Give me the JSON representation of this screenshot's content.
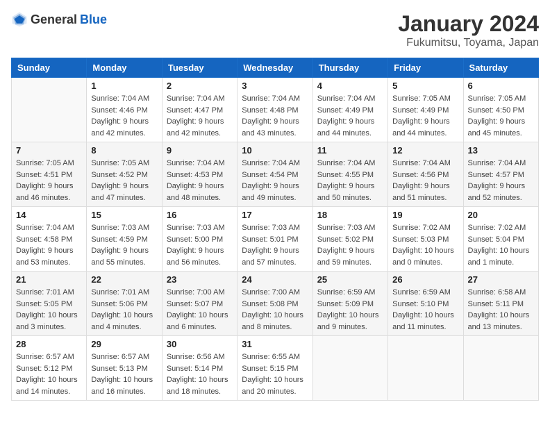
{
  "header": {
    "logo_general": "General",
    "logo_blue": "Blue",
    "month": "January 2024",
    "location": "Fukumitsu, Toyama, Japan"
  },
  "weekdays": [
    "Sunday",
    "Monday",
    "Tuesday",
    "Wednesday",
    "Thursday",
    "Friday",
    "Saturday"
  ],
  "weeks": [
    [
      {
        "day": "",
        "info": ""
      },
      {
        "day": "1",
        "info": "Sunrise: 7:04 AM\nSunset: 4:46 PM\nDaylight: 9 hours\nand 42 minutes."
      },
      {
        "day": "2",
        "info": "Sunrise: 7:04 AM\nSunset: 4:47 PM\nDaylight: 9 hours\nand 42 minutes."
      },
      {
        "day": "3",
        "info": "Sunrise: 7:04 AM\nSunset: 4:48 PM\nDaylight: 9 hours\nand 43 minutes."
      },
      {
        "day": "4",
        "info": "Sunrise: 7:04 AM\nSunset: 4:49 PM\nDaylight: 9 hours\nand 44 minutes."
      },
      {
        "day": "5",
        "info": "Sunrise: 7:05 AM\nSunset: 4:49 PM\nDaylight: 9 hours\nand 44 minutes."
      },
      {
        "day": "6",
        "info": "Sunrise: 7:05 AM\nSunset: 4:50 PM\nDaylight: 9 hours\nand 45 minutes."
      }
    ],
    [
      {
        "day": "7",
        "info": "Sunrise: 7:05 AM\nSunset: 4:51 PM\nDaylight: 9 hours\nand 46 minutes."
      },
      {
        "day": "8",
        "info": "Sunrise: 7:05 AM\nSunset: 4:52 PM\nDaylight: 9 hours\nand 47 minutes."
      },
      {
        "day": "9",
        "info": "Sunrise: 7:04 AM\nSunset: 4:53 PM\nDaylight: 9 hours\nand 48 minutes."
      },
      {
        "day": "10",
        "info": "Sunrise: 7:04 AM\nSunset: 4:54 PM\nDaylight: 9 hours\nand 49 minutes."
      },
      {
        "day": "11",
        "info": "Sunrise: 7:04 AM\nSunset: 4:55 PM\nDaylight: 9 hours\nand 50 minutes."
      },
      {
        "day": "12",
        "info": "Sunrise: 7:04 AM\nSunset: 4:56 PM\nDaylight: 9 hours\nand 51 minutes."
      },
      {
        "day": "13",
        "info": "Sunrise: 7:04 AM\nSunset: 4:57 PM\nDaylight: 9 hours\nand 52 minutes."
      }
    ],
    [
      {
        "day": "14",
        "info": "Sunrise: 7:04 AM\nSunset: 4:58 PM\nDaylight: 9 hours\nand 53 minutes."
      },
      {
        "day": "15",
        "info": "Sunrise: 7:03 AM\nSunset: 4:59 PM\nDaylight: 9 hours\nand 55 minutes."
      },
      {
        "day": "16",
        "info": "Sunrise: 7:03 AM\nSunset: 5:00 PM\nDaylight: 9 hours\nand 56 minutes."
      },
      {
        "day": "17",
        "info": "Sunrise: 7:03 AM\nSunset: 5:01 PM\nDaylight: 9 hours\nand 57 minutes."
      },
      {
        "day": "18",
        "info": "Sunrise: 7:03 AM\nSunset: 5:02 PM\nDaylight: 9 hours\nand 59 minutes."
      },
      {
        "day": "19",
        "info": "Sunrise: 7:02 AM\nSunset: 5:03 PM\nDaylight: 10 hours\nand 0 minutes."
      },
      {
        "day": "20",
        "info": "Sunrise: 7:02 AM\nSunset: 5:04 PM\nDaylight: 10 hours\nand 1 minute."
      }
    ],
    [
      {
        "day": "21",
        "info": "Sunrise: 7:01 AM\nSunset: 5:05 PM\nDaylight: 10 hours\nand 3 minutes."
      },
      {
        "day": "22",
        "info": "Sunrise: 7:01 AM\nSunset: 5:06 PM\nDaylight: 10 hours\nand 4 minutes."
      },
      {
        "day": "23",
        "info": "Sunrise: 7:00 AM\nSunset: 5:07 PM\nDaylight: 10 hours\nand 6 minutes."
      },
      {
        "day": "24",
        "info": "Sunrise: 7:00 AM\nSunset: 5:08 PM\nDaylight: 10 hours\nand 8 minutes."
      },
      {
        "day": "25",
        "info": "Sunrise: 6:59 AM\nSunset: 5:09 PM\nDaylight: 10 hours\nand 9 minutes."
      },
      {
        "day": "26",
        "info": "Sunrise: 6:59 AM\nSunset: 5:10 PM\nDaylight: 10 hours\nand 11 minutes."
      },
      {
        "day": "27",
        "info": "Sunrise: 6:58 AM\nSunset: 5:11 PM\nDaylight: 10 hours\nand 13 minutes."
      }
    ],
    [
      {
        "day": "28",
        "info": "Sunrise: 6:57 AM\nSunset: 5:12 PM\nDaylight: 10 hours\nand 14 minutes."
      },
      {
        "day": "29",
        "info": "Sunrise: 6:57 AM\nSunset: 5:13 PM\nDaylight: 10 hours\nand 16 minutes."
      },
      {
        "day": "30",
        "info": "Sunrise: 6:56 AM\nSunset: 5:14 PM\nDaylight: 10 hours\nand 18 minutes."
      },
      {
        "day": "31",
        "info": "Sunrise: 6:55 AM\nSunset: 5:15 PM\nDaylight: 10 hours\nand 20 minutes."
      },
      {
        "day": "",
        "info": ""
      },
      {
        "day": "",
        "info": ""
      },
      {
        "day": "",
        "info": ""
      }
    ]
  ]
}
